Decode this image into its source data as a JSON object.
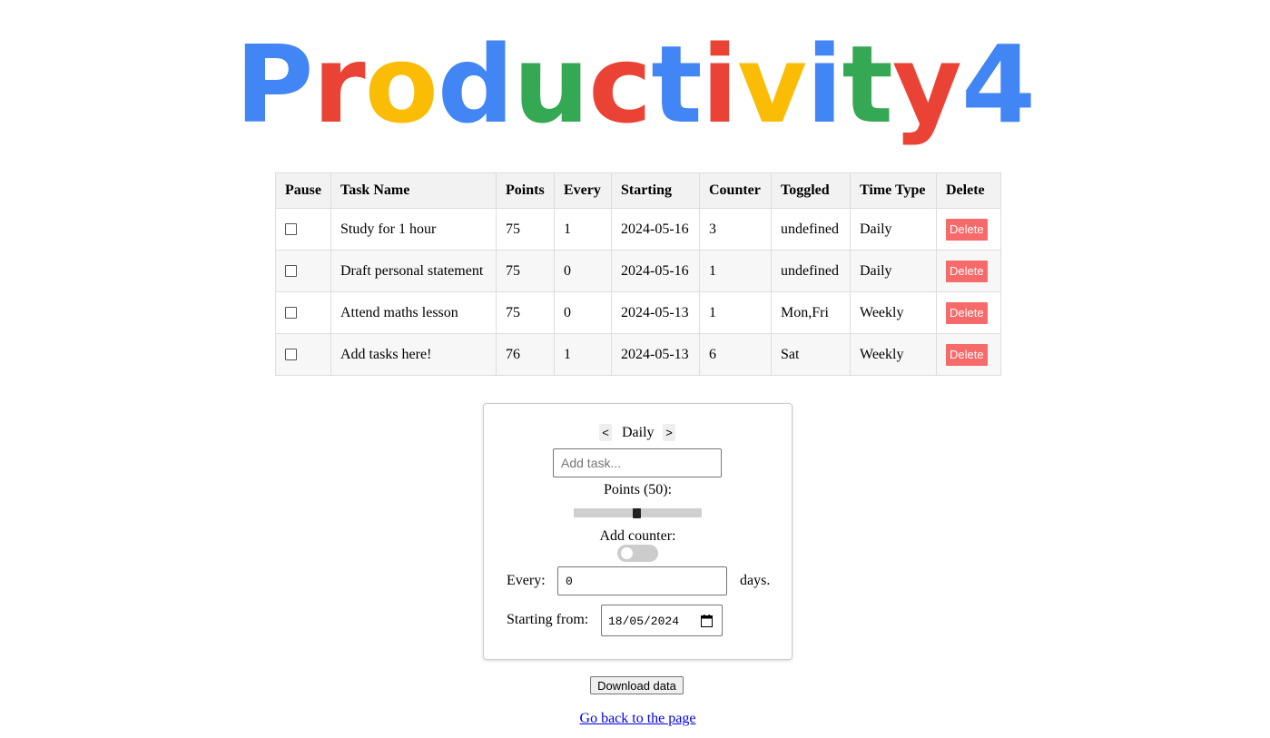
{
  "logo": {
    "letters": [
      {
        "ch": "P",
        "color": "#4285f4"
      },
      {
        "ch": "r",
        "color": "#ea4335"
      },
      {
        "ch": "o",
        "color": "#fbbc05"
      },
      {
        "ch": "d",
        "color": "#4285f4"
      },
      {
        "ch": "u",
        "color": "#34a853"
      },
      {
        "ch": "c",
        "color": "#ea4335"
      },
      {
        "ch": "t",
        "color": "#4285f4"
      },
      {
        "ch": "i",
        "color": "#ea4335"
      },
      {
        "ch": "v",
        "color": "#fbbc05"
      },
      {
        "ch": "i",
        "color": "#4285f4"
      },
      {
        "ch": "t",
        "color": "#34a853"
      },
      {
        "ch": "y",
        "color": "#ea4335"
      },
      {
        "ch": "4",
        "color": "#4285f4"
      }
    ]
  },
  "table": {
    "headers": {
      "pause": "Pause",
      "task_name": "Task Name",
      "points": "Points",
      "every": "Every",
      "starting": "Starting",
      "counter": "Counter",
      "toggled": "Toggled",
      "time_type": "Time Type",
      "delete": "Delete"
    },
    "rows": [
      {
        "task_name": "Study for 1 hour",
        "points": "75",
        "every": "1",
        "starting": "2024-05-16",
        "counter": "3",
        "toggled": "undefined",
        "time_type": "Daily",
        "delete_label": "Delete",
        "paused": false
      },
      {
        "task_name": "Draft personal statement",
        "points": "75",
        "every": "0",
        "starting": "2024-05-16",
        "counter": "1",
        "toggled": "undefined",
        "time_type": "Daily",
        "delete_label": "Delete",
        "paused": false
      },
      {
        "task_name": "Attend maths lesson",
        "points": "75",
        "every": "0",
        "starting": "2024-05-13",
        "counter": "1",
        "toggled": "Mon,Fri",
        "time_type": "Weekly",
        "delete_label": "Delete",
        "paused": false
      },
      {
        "task_name": "Add tasks here!",
        "points": "76",
        "every": "1",
        "starting": "2024-05-13",
        "counter": "6",
        "toggled": "Sat",
        "time_type": "Weekly",
        "delete_label": "Delete",
        "paused": false
      }
    ]
  },
  "form": {
    "prev_label": "<",
    "next_label": ">",
    "time_type": "Daily",
    "task_placeholder": "Add task...",
    "points_label": "Points (50):",
    "points_value": 50,
    "points_fraction": 0.49,
    "counter_label": "Add counter:",
    "counter_on": false,
    "every_label": "Every:",
    "every_value": "0",
    "days_label": "days.",
    "starting_label": "Starting from:",
    "starting_value": "18/05/2024"
  },
  "download_label": "Download data",
  "back_link_label": "Go back to the page",
  "colors": {
    "delete_button": "#f66a6a",
    "link": "#0000ee"
  }
}
